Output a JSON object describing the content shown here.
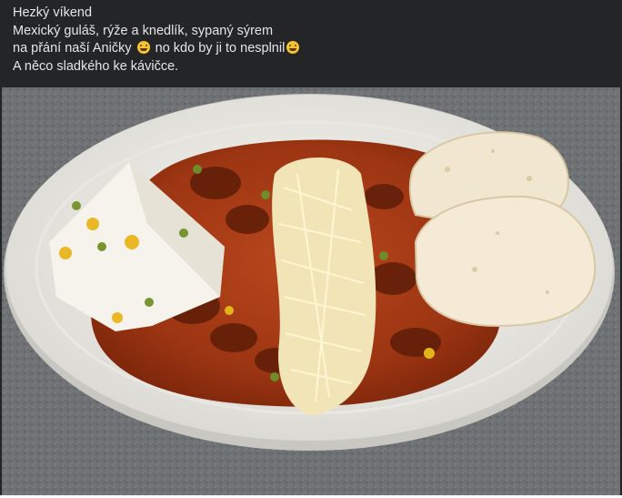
{
  "post": {
    "lines": [
      {
        "text": "Hezký víkend"
      },
      {
        "text": "Mexický guláš, rýže a knedlík, sypaný sýrem"
      },
      {
        "before": "na přání naší Aničky",
        "middle": " no kdo by ji to nesplnil",
        "emoji_1": "upside-down-face-emoji",
        "emoji_2": "grinning-face-emoji"
      },
      {
        "text": "A něco sladkého ke kávičce."
      }
    ]
  },
  "colors": {
    "background": "#242526",
    "text": "#e4e6eb"
  }
}
